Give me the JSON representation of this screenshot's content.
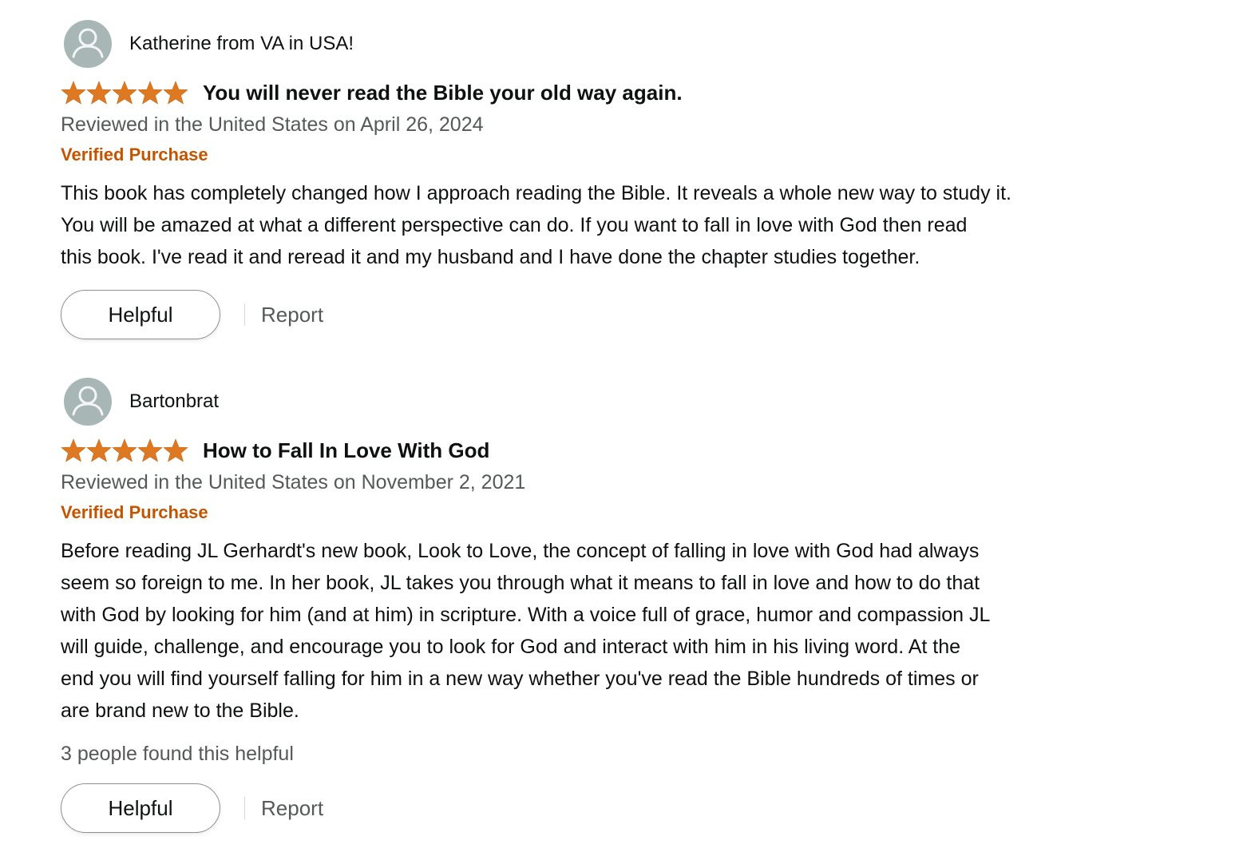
{
  "colors": {
    "star": "#de7921",
    "verified": "#c45500",
    "secondary_text": "#565959",
    "primary_text": "#0f1111",
    "avatar_bg": "#a9b6b6"
  },
  "reviews": [
    {
      "author": "Katherine from VA in USA!",
      "rating": 5,
      "title": "You will never read the Bible your old way again.",
      "date": "Reviewed in the United States on April 26, 2024",
      "verified": "Verified Purchase",
      "body": [
        "This book has completely changed how I approach reading the Bible. It reveals a whole new way to study it.",
        "You will be amazed at what a different perspective can do. If you want to fall in love with God then read",
        "this book. I've read it and reread it and my husband and I have done the chapter studies together."
      ],
      "helpful_label": "Helpful",
      "report_label": "Report"
    },
    {
      "author": "Bartonbrat",
      "rating": 5,
      "title": "How to Fall In Love With God",
      "date": "Reviewed in the United States on November 2, 2021",
      "verified": "Verified Purchase",
      "body": [
        "Before reading JL Gerhardt's new book, Look to Love, the concept of falling in love with God had always",
        "seem so foreign to me. In her book, JL takes you through what it means to fall in love and how to do that",
        "with God by looking for him (and at him) in scripture. With a voice full of grace, humor and compassion JL",
        "will guide, challenge, and encourage you to look for God and interact with him in his living word. At the",
        "end you will find yourself falling for him in a new way whether you've read the Bible hundreds of times or",
        "are brand new to the Bible."
      ],
      "helpful_count": "3 people found this helpful",
      "helpful_label": "Helpful",
      "report_label": "Report"
    }
  ]
}
